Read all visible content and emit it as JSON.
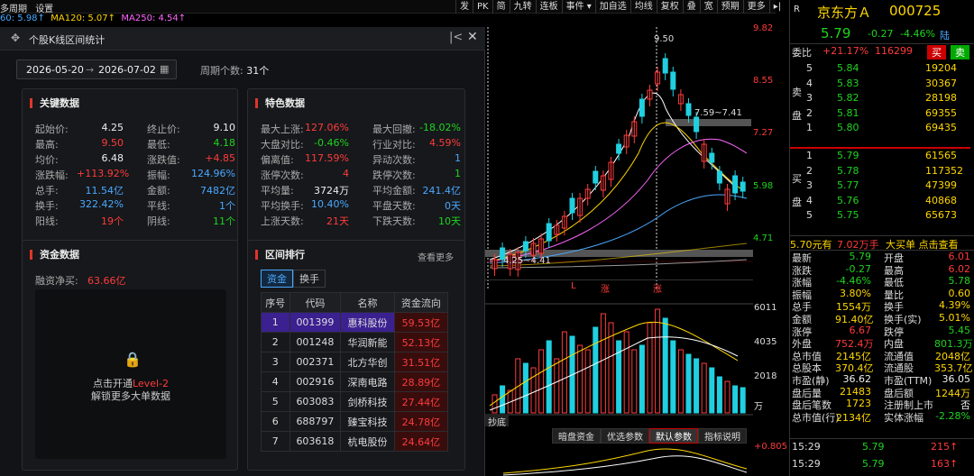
{
  "menu": {
    "items": [
      "多周期",
      "设置"
    ]
  },
  "ma_line": {
    "ma60": "60: 5.98↑",
    "ma120": "MA120: 5.07↑",
    "ma250": "MA250: 4.54↑"
  },
  "toolbar": [
    "发",
    "PK",
    "简",
    "九转",
    "连板",
    "事件 ▾",
    "加自选",
    "均线",
    "复权",
    "叠",
    "宽",
    "预期",
    "更多",
    "▸|"
  ],
  "dialog": {
    "title": "个股K线区间统计",
    "date_start": "2026-05-20",
    "date_arrow": "→",
    "date_end": "2026-07-02",
    "period_label": "周期个数:",
    "period_count": "31个",
    "key_data": {
      "title": "关键数据",
      "rows": [
        {
          "k1": "起始价:",
          "v1": "4.25",
          "c1": "white",
          "k2": "终止价:",
          "v2": "9.10",
          "c2": "white"
        },
        {
          "k1": "最高:",
          "v1": "9.50",
          "c1": "red",
          "k2": "最低:",
          "v2": "4.18",
          "c2": "green"
        },
        {
          "k1": "均价:",
          "v1": "6.48",
          "c1": "white",
          "k2": "涨跌值:",
          "v2": "+4.85",
          "c2": "red"
        },
        {
          "k1": "涨跌幅:",
          "v1": "+113.92%",
          "c1": "red",
          "k2": "振幅:",
          "v2": "124.96%",
          "c2": "blue"
        },
        {
          "k1": "总手:",
          "v1": "11.54亿",
          "c1": "blue",
          "k2": "金额:",
          "v2": "7482亿",
          "c2": "blue"
        },
        {
          "k1": "换手:",
          "v1": "322.42%",
          "c1": "blue",
          "k2": "平线:",
          "v2": "1个",
          "c2": "blue"
        },
        {
          "k1": "阳线:",
          "v1": "19个",
          "c1": "red",
          "k2": "阴线:",
          "v2": "11个",
          "c2": "green"
        }
      ]
    },
    "special_data": {
      "title": "特色数据",
      "rows": [
        {
          "k1": "最大上涨:",
          "v1": "127.06%",
          "c1": "red",
          "k2": "最大回撤:",
          "v2": "-18.02%",
          "c2": "green"
        },
        {
          "k1": "大盘对比:",
          "v1": "-0.46%",
          "c1": "green",
          "k2": "行业对比:",
          "v2": "4.59%",
          "c2": "red"
        },
        {
          "k1": "偏离值:",
          "v1": "117.59%",
          "c1": "red",
          "k2": "异动次数:",
          "v2": "1",
          "c2": "blue"
        },
        {
          "k1": "涨停次数:",
          "v1": "4",
          "c1": "red",
          "k2": "跌停次数:",
          "v2": "1",
          "c2": "green"
        },
        {
          "k1": "平均量:",
          "v1": "3724万",
          "c1": "white",
          "k2": "平均金额:",
          "v2": "241.4亿",
          "c2": "blue"
        },
        {
          "k1": "平均换手:",
          "v1": "10.40%",
          "c1": "blue",
          "k2": "平盘天数:",
          "v2": "0天",
          "c2": "blue"
        },
        {
          "k1": "上涨天数:",
          "v1": "21天",
          "c1": "red",
          "k2": "下跌天数:",
          "v2": "10天",
          "c2": "green"
        }
      ]
    },
    "capital": {
      "title": "资金数据",
      "net_label": "融资净买:",
      "net_value": "63.66亿",
      "lock_line1_prefix": "点击开通",
      "lock_line1_em": "Level-2",
      "lock_line2": "解锁更多大单数据"
    },
    "ranking": {
      "title": "区间排行",
      "more": "查看更多",
      "tabs": [
        "资金",
        "换手"
      ],
      "headers": [
        "序号",
        "代码",
        "名称",
        "资金流向"
      ],
      "rows": [
        {
          "no": "1",
          "code": "001399",
          "name": "惠科股份",
          "flow": "59.53亿"
        },
        {
          "no": "2",
          "code": "001248",
          "name": "华润新能",
          "flow": "52.13亿"
        },
        {
          "no": "3",
          "code": "002371",
          "name": "北方华创",
          "flow": "31.51亿"
        },
        {
          "no": "4",
          "code": "002916",
          "name": "深南电路",
          "flow": "28.89亿"
        },
        {
          "no": "5",
          "code": "603083",
          "name": "剑桥科技",
          "flow": "27.44亿"
        },
        {
          "no": "6",
          "code": "688797",
          "name": "臻宝科技",
          "flow": "24.78亿"
        },
        {
          "no": "7",
          "code": "603618",
          "name": "杭电股份",
          "flow": "24.64亿"
        }
      ]
    }
  },
  "chart": {
    "price_labels": [
      "9.82",
      "8.55",
      "7.27",
      "5.98",
      "4.71"
    ],
    "high_mark": "9.50",
    "low_mark": "4.25~4.41",
    "range_mark": "7.59~7.41",
    "markers": [
      "L",
      "涨",
      "涨"
    ],
    "vol_labels": [
      "6011",
      "4035",
      "2018",
      "万"
    ],
    "bottom_tab": "抄底",
    "bottom_tabs": [
      "暗盘资金",
      "优选参数",
      "默认参数",
      "指标说明"
    ],
    "bottom_value": "+0.805"
  },
  "quote": {
    "logo": "R",
    "name": "京东方Ａ",
    "code": "000725",
    "price": "5.79",
    "change": "-0.27",
    "pct": "-4.46%",
    "badge": "陆",
    "webi_label": "委比",
    "webi_value": "+21.17%",
    "webi_diff": "116299",
    "buy_btn": "买",
    "sell_btn": "卖",
    "sell_side": "卖盘",
    "buy_side": "买盘",
    "asks": [
      {
        "lvl": "5",
        "price": "5.84",
        "vol": "19204"
      },
      {
        "lvl": "4",
        "price": "5.83",
        "vol": "30367"
      },
      {
        "lvl": "3",
        "price": "5.82",
        "vol": "28198"
      },
      {
        "lvl": "2",
        "price": "5.81",
        "vol": "69355"
      },
      {
        "lvl": "1",
        "price": "5.80",
        "vol": "69435"
      }
    ],
    "bids": [
      {
        "lvl": "1",
        "price": "5.79",
        "vol": "61565"
      },
      {
        "lvl": "2",
        "price": "5.78",
        "vol": "117352"
      },
      {
        "lvl": "3",
        "price": "5.77",
        "vol": "47399"
      },
      {
        "lvl": "4",
        "price": "5.76",
        "vol": "40868"
      },
      {
        "lvl": "5",
        "price": "5.75",
        "vol": "65673"
      }
    ],
    "big_order": {
      "price": "5.70元有",
      "vol": "7.02万手",
      "text": "大买单 点击查看"
    },
    "stats": [
      {
        "k1": "最新",
        "v1": "5.79",
        "c1": "green",
        "k2": "开盘",
        "v2": "6.01",
        "c2": "red"
      },
      {
        "k1": "涨跌",
        "v1": "-0.27",
        "c1": "green",
        "k2": "最高",
        "v2": "6.02",
        "c2": "red"
      },
      {
        "k1": "涨幅",
        "v1": "-4.46%",
        "c1": "green",
        "k2": "最低",
        "v2": "5.78",
        "c2": "green"
      },
      {
        "k1": "振幅",
        "v1": "3.80%",
        "c1": "yellow",
        "k2": "量比",
        "v2": "0.60",
        "c2": "yellow"
      },
      {
        "k1": "总手",
        "v1": "1554万",
        "c1": "yellow",
        "k2": "换手",
        "v2": "4.39%",
        "c2": "yellow"
      },
      {
        "k1": "金额",
        "v1": "91.40亿",
        "c1": "yellow",
        "k2": "换手(实)",
        "v2": "5.01%",
        "c2": "yellow"
      },
      {
        "k1": "涨停",
        "v1": "6.67",
        "c1": "red",
        "k2": "跌停",
        "v2": "5.45",
        "c2": "green"
      },
      {
        "k1": "外盘",
        "v1": "752.4万",
        "c1": "red",
        "k2": "内盘",
        "v2": "801.3万",
        "c2": "green"
      },
      {
        "k1": "总市值",
        "v1": "2145亿",
        "c1": "yellow",
        "k2": "流通值",
        "v2": "2048亿",
        "c2": "yellow"
      },
      {
        "k1": "总股本",
        "v1": "370.4亿",
        "c1": "yellow",
        "k2": "流通股",
        "v2": "353.7亿",
        "c2": "yellow"
      },
      {
        "k1": "市盈(静)",
        "v1": "36.62",
        "c1": "white",
        "k2": "市盈(TTM)",
        "v2": "36.05",
        "c2": "white"
      },
      {
        "k1": "盘后量",
        "v1": "21483",
        "c1": "yellow",
        "k2": "盘后额",
        "v2": "1244万",
        "c2": "yellow"
      },
      {
        "k1": "盘后笔数",
        "v1": "1723",
        "c1": "yellow",
        "k2": "注册制上市",
        "v2": "否",
        "c2": "white"
      },
      {
        "k1": "总市值(行)",
        "v1": "2134亿",
        "c1": "yellow",
        "k2": "实体涨幅",
        "v2": "-2.28%",
        "c2": "green"
      }
    ],
    "ticks": [
      {
        "time": "15:29",
        "price": "5.79",
        "vol": "215↑"
      },
      {
        "time": "15:29",
        "price": "5.79",
        "vol": "163↑"
      }
    ]
  }
}
